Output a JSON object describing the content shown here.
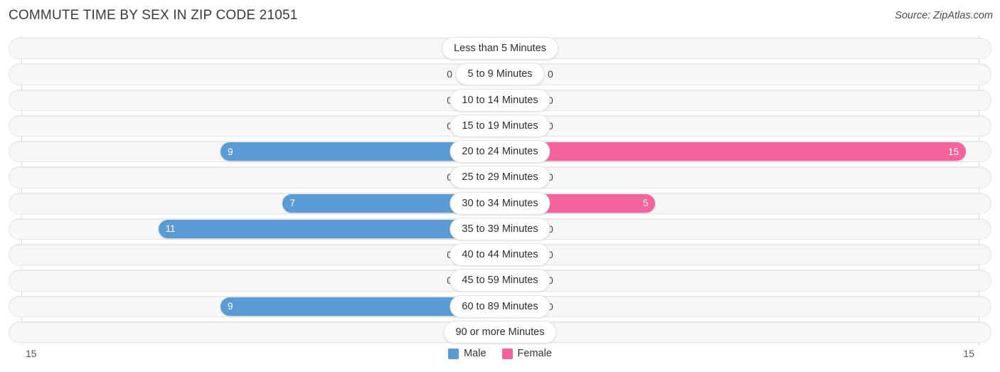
{
  "header": {
    "title": "COMMUTE TIME BY SEX IN ZIP CODE 21051",
    "source": "Source: ZipAtlas.com"
  },
  "legend": {
    "male_label": "Male",
    "female_label": "Female",
    "male_color": "#5b9bd5",
    "female_color": "#f4639b"
  },
  "axis": {
    "left_label": "15",
    "right_label": "15"
  },
  "chart_data": {
    "type": "bar",
    "title": "COMMUTE TIME BY SEX IN ZIP CODE 21051",
    "orientation": "horizontal-diverging",
    "xlabel": "",
    "ylabel": "",
    "axis_max": 15,
    "grid": true,
    "legend_position": "bottom-center",
    "categories": [
      "Less than 5 Minutes",
      "5 to 9 Minutes",
      "10 to 14 Minutes",
      "15 to 19 Minutes",
      "20 to 24 Minutes",
      "25 to 29 Minutes",
      "30 to 34 Minutes",
      "35 to 39 Minutes",
      "40 to 44 Minutes",
      "45 to 59 Minutes",
      "60 to 89 Minutes",
      "90 or more Minutes"
    ],
    "series": [
      {
        "name": "Male",
        "values": [
          0,
          0,
          0,
          0,
          9,
          0,
          7,
          11,
          0,
          0,
          9,
          0
        ]
      },
      {
        "name": "Female",
        "values": [
          0,
          0,
          0,
          0,
          15,
          0,
          5,
          0,
          0,
          0,
          0,
          0
        ]
      }
    ]
  }
}
